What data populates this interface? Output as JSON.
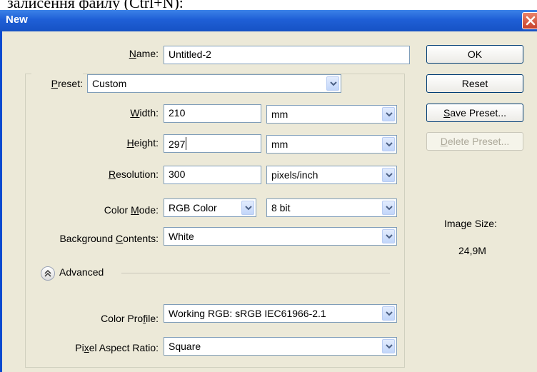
{
  "top_strip_text": "залисення файлу (Ctrl+N):",
  "dialog": {
    "title": "New",
    "name": {
      "label_pre": "",
      "label_u": "N",
      "label_post": "ame:",
      "value": "Untitled-2"
    },
    "preset": {
      "label_pre": "",
      "label_u": "P",
      "label_post": "reset:",
      "value": "Custom"
    },
    "width": {
      "label_pre": "",
      "label_u": "W",
      "label_post": "idth:",
      "value": "210",
      "unit": "mm"
    },
    "height": {
      "label_pre": "",
      "label_u": "H",
      "label_post": "eight:",
      "value": "297",
      "unit": "mm"
    },
    "resolution": {
      "label_pre": "",
      "label_u": "R",
      "label_post": "esolution:",
      "value": "300",
      "unit": "pixels/inch"
    },
    "color_mode": {
      "label_pre": "Color ",
      "label_u": "M",
      "label_post": "ode:",
      "value": "RGB Color",
      "depth": "8 bit"
    },
    "background": {
      "label_pre": "Background ",
      "label_u": "C",
      "label_post": "ontents:",
      "value": "White"
    },
    "advanced": {
      "label": "Advanced"
    },
    "color_profile": {
      "label_pre": "Color Pro",
      "label_u": "f",
      "label_post": "ile:",
      "value": "Working RGB:  sRGB IEC61966-2.1"
    },
    "pixel_aspect": {
      "label_pre": "Pi",
      "label_u": "x",
      "label_post": "el Aspect Ratio:",
      "value": "Square"
    },
    "buttons": {
      "ok": "OK",
      "reset": "Reset",
      "save_preset_u": "S",
      "save_preset_rest": "ave Preset...",
      "delete_preset_u": "D",
      "delete_preset_rest": "elete Preset..."
    },
    "image_size": {
      "label": "Image Size:",
      "value": "24,9M"
    }
  },
  "colors": {
    "titlebar": "#1f5fd6",
    "client_bg": "#ece9d8",
    "field_border": "#7f9db9",
    "close": "#c6412a"
  }
}
